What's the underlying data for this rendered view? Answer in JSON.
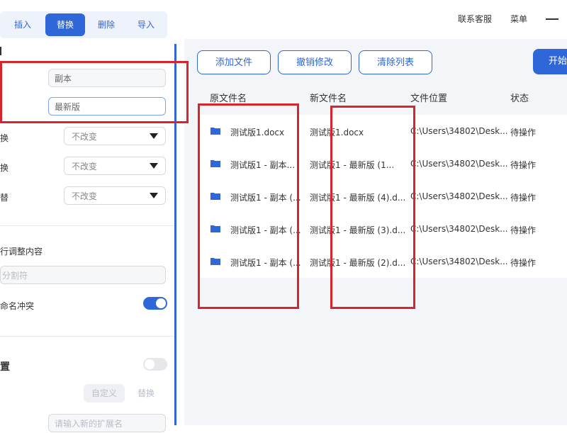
{
  "tabs": [
    {
      "label": "插入",
      "active": false
    },
    {
      "label": "替换",
      "active": true
    },
    {
      "label": "删除",
      "active": false
    },
    {
      "label": "导入",
      "active": false
    }
  ],
  "left": {
    "copy_input": {
      "value": "副本"
    },
    "newest_input": {
      "value": "最新版"
    },
    "select_rows": [
      {
        "label_partial": "换",
        "value": "不改变"
      },
      {
        "label_partial": "换",
        "value": "不改变"
      },
      {
        "label_partial": "替",
        "value": "不改变"
      }
    ],
    "adjust_content_label": "行调整内容",
    "separator_placeholder": "分割符",
    "name_conflict_label": "命名冲突",
    "section_label": "置",
    "custom_button": "自定义",
    "replace_button": "替换",
    "ext_placeholder": "请输入新的扩展名"
  },
  "top": {
    "links": [
      {
        "label": "联系客服"
      },
      {
        "label": "菜单"
      }
    ]
  },
  "actions": {
    "add_file": "添加文件",
    "undo": "撤销修改",
    "clear": "清除列表",
    "start": "开始"
  },
  "table": {
    "headers": [
      "原文件名",
      "新文件名",
      "文件位置",
      "状态"
    ],
    "rows": [
      {
        "orig": "测试版1.docx",
        "new": "测试版1.docx",
        "loc": "C:\\Users\\34802\\Desk...",
        "status": "待操作"
      },
      {
        "orig": "测试版1 - 副本...",
        "new": "测试版1 - 最新版 (1...",
        "loc": "C:\\Users\\34802\\Desk...",
        "status": "待操作"
      },
      {
        "orig": "测试版1 - 副本 (...",
        "new": "测试版1 - 最新版 (4).d...",
        "loc": "C:\\Users\\34802\\Desk...",
        "status": "待操作"
      },
      {
        "orig": "测试版1 - 副本 (...",
        "new": "测试版1 - 最新版 (3).d...",
        "loc": "C:\\Users\\34802\\Desk...",
        "status": "待操作"
      },
      {
        "orig": "测试版1 - 副本 (...",
        "new": "测试版1 - 最新版 (2).d...",
        "loc": "C:\\Users\\34802\\Desk...",
        "status": "待操作"
      }
    ]
  },
  "colors": {
    "accent": "#2f67d8",
    "annotation": "#d4262c"
  }
}
